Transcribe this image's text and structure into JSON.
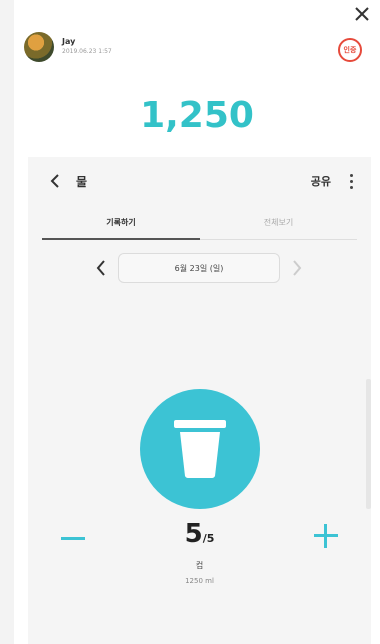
{
  "header": {
    "user_name": "Jay",
    "timestamp": "2019.06.23 1:57",
    "badge_text": "인증"
  },
  "score": "1,250",
  "panel": {
    "title": "물",
    "share_label": "공유",
    "tabs": [
      {
        "label": "기록하기",
        "active": true
      },
      {
        "label": "전체보기",
        "active": false
      }
    ],
    "date": "6월 23일 (일)",
    "count": "5",
    "count_total": "/5",
    "unit": "컵",
    "volume": "1250 ml"
  },
  "colors": {
    "accent": "#33c2c8",
    "cup_circle": "#3cc3d4",
    "badge": "#e64a3b"
  },
  "icons": {
    "close": "close-icon",
    "back": "back-arrow-icon",
    "more": "more-vertical-icon",
    "prev": "chevron-left-icon",
    "next": "chevron-right-icon",
    "cup": "water-cup-icon",
    "minus": "minus-icon",
    "plus": "plus-icon"
  }
}
